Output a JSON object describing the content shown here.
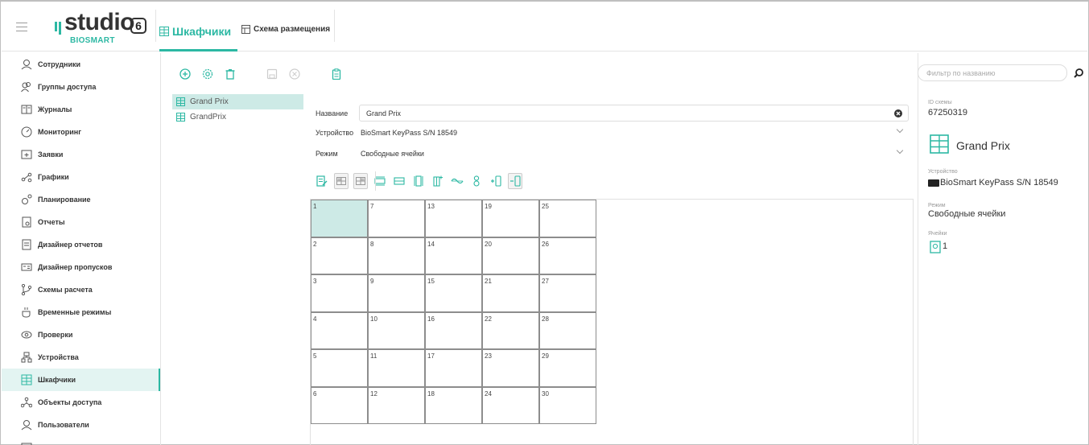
{
  "header": {
    "logo_word": "studio",
    "logo_version": "6",
    "logo_sub": "BIOSMART",
    "tab_main": "Шкафчики",
    "tab_secondary": "Схема размещения"
  },
  "colors": {
    "accent": "#2cb8a3",
    "selected_bg": "#cdeae6"
  },
  "sidebar": {
    "items": [
      {
        "label": "Сотрудники",
        "icon": "person-icon"
      },
      {
        "label": "Группы доступа",
        "icon": "people-group-icon"
      },
      {
        "label": "Журналы",
        "icon": "journal-icon"
      },
      {
        "label": "Мониторинг",
        "icon": "gauge-icon"
      },
      {
        "label": "Заявки",
        "icon": "request-icon"
      },
      {
        "label": "Графики",
        "icon": "graph-icon"
      },
      {
        "label": "Планирование",
        "icon": "planning-icon"
      },
      {
        "label": "Отчеты",
        "icon": "report-icon"
      },
      {
        "label": "Дизайнер отчетов",
        "icon": "report-designer-icon"
      },
      {
        "label": "Дизайнер пропусков",
        "icon": "pass-designer-icon"
      },
      {
        "label": "Схемы расчета",
        "icon": "branch-icon"
      },
      {
        "label": "Временные режимы",
        "icon": "coffee-icon"
      },
      {
        "label": "Проверки",
        "icon": "eye-icon"
      },
      {
        "label": "Устройства",
        "icon": "devices-icon"
      },
      {
        "label": "Шкафчики",
        "icon": "locker-icon",
        "active": true
      },
      {
        "label": "Объекты доступа",
        "icon": "access-objects-icon"
      },
      {
        "label": "Пользователи",
        "icon": "user-icon"
      }
    ]
  },
  "list": {
    "items": [
      {
        "label": "Grand Prix",
        "selected": true
      },
      {
        "label": "GrandPrix",
        "selected": false
      }
    ]
  },
  "form": {
    "name_label": "Название",
    "name_value": "Grand Prix",
    "device_label": "Устройство",
    "device_value": "BioSmart KeyPass S/N 18549",
    "mode_label": "Режим",
    "mode_value": "Свободные ячейки"
  },
  "grid": {
    "columns": [
      [
        "1",
        "2",
        "3",
        "4",
        "5",
        "6"
      ],
      [
        "7",
        "8",
        "9",
        "10",
        "11",
        "12"
      ],
      [
        "13",
        "14",
        "15",
        "16",
        "17",
        "18"
      ],
      [
        "19",
        "20",
        "21",
        "22",
        "23",
        "24"
      ],
      [
        "25",
        "26",
        "27",
        "28",
        "29",
        "30"
      ]
    ],
    "selected": "1"
  },
  "right": {
    "search_placeholder": "Фильтр по названию",
    "id_label": "ID схемы",
    "id_value": "67250319",
    "scheme_name": "Grand Prix",
    "device_label": "Устройство",
    "device_value": "BioSmart KeyPass S/N 18549",
    "mode_label": "Режим",
    "mode_value": "Свободные ячейки",
    "cells_label": "Ячейки",
    "cells_value": "1"
  }
}
